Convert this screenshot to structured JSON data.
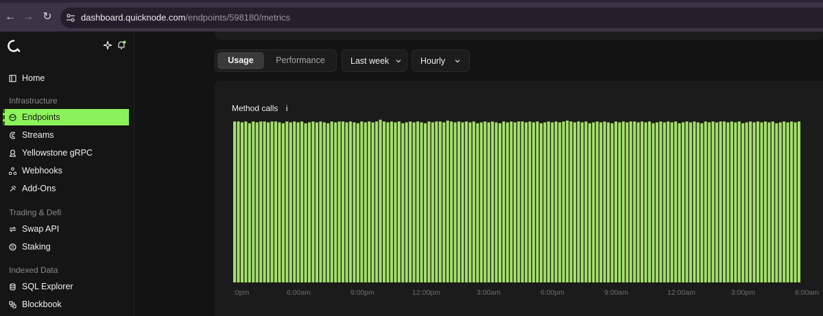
{
  "browser": {
    "url_host": "dashboard.quicknode.com",
    "url_path": "/endpoints/598180/metrics"
  },
  "sidebar": {
    "items": [
      {
        "label": "Home",
        "icon": "home-icon",
        "active": false
      },
      {
        "label": "Endpoints",
        "icon": "endpoints-icon",
        "active": true
      },
      {
        "label": "Streams",
        "icon": "streams-icon",
        "active": false
      },
      {
        "label": "Yellowstone gRPC",
        "icon": "yellowstone-icon",
        "active": false
      },
      {
        "label": "Webhooks",
        "icon": "webhooks-icon",
        "active": false
      },
      {
        "label": "Add-Ons",
        "icon": "addons-icon",
        "active": false
      },
      {
        "label": "Swap API",
        "icon": "swap-icon",
        "active": false
      },
      {
        "label": "Staking",
        "icon": "staking-icon",
        "active": false
      },
      {
        "label": "SQL Explorer",
        "icon": "database-icon",
        "active": false
      },
      {
        "label": "Blockbook",
        "icon": "blockbook-icon",
        "active": false
      }
    ],
    "sections": [
      "Infrastructure",
      "Trading & Defi",
      "Indexed Data"
    ],
    "accent": "#8cf25a"
  },
  "tabs": {
    "usage": "Usage",
    "performance": "Performance"
  },
  "filters": {
    "range": "Last week",
    "granularity": "Hourly"
  },
  "chart_data": {
    "type": "bar",
    "title": "Method calls",
    "info": "i",
    "bar_color": "#a3e06a",
    "tick_labels": [
      ":0pm",
      "6:00am",
      "9:00pm",
      "12:00pm",
      "3:00am",
      "6:00pm",
      "9:00am",
      "12:00am",
      "3:00pm",
      "6:00am"
    ],
    "y_visible_fraction_base": 0.91,
    "values": [
      0.91,
      0.91,
      0.905,
      0.91,
      0.9,
      0.91,
      0.905,
      0.91,
      0.91,
      0.905,
      0.91,
      0.91,
      0.905,
      0.9,
      0.91,
      0.905,
      0.91,
      0.905,
      0.91,
      0.9,
      0.905,
      0.91,
      0.905,
      0.91,
      0.905,
      0.9,
      0.91,
      0.905,
      0.91,
      0.91,
      0.905,
      0.91,
      0.905,
      0.9,
      0.91,
      0.905,
      0.91,
      0.905,
      0.91,
      0.92,
      0.91,
      0.905,
      0.91,
      0.905,
      0.91,
      0.9,
      0.905,
      0.91,
      0.905,
      0.91,
      0.905,
      0.9,
      0.91,
      0.905,
      0.91,
      0.91,
      0.905,
      0.915,
      0.91,
      0.905,
      0.91,
      0.905,
      0.91,
      0.905,
      0.91,
      0.9,
      0.905,
      0.91,
      0.905,
      0.91,
      0.905,
      0.9,
      0.91,
      0.905,
      0.91,
      0.905,
      0.91,
      0.91,
      0.905,
      0.91,
      0.905,
      0.91,
      0.9,
      0.905,
      0.91,
      0.905,
      0.91,
      0.905,
      0.91,
      0.915,
      0.91,
      0.905,
      0.91,
      0.905,
      0.91,
      0.9,
      0.905,
      0.91,
      0.905,
      0.91,
      0.905,
      0.9,
      0.91,
      0.905,
      0.91,
      0.905,
      0.91,
      0.91,
      0.905,
      0.91,
      0.905,
      0.91,
      0.9,
      0.905,
      0.91,
      0.905,
      0.91,
      0.905,
      0.91,
      0.9,
      0.905,
      0.91,
      0.905,
      0.91,
      0.905,
      0.9,
      0.91,
      0.905,
      0.91,
      0.905,
      0.91,
      0.91,
      0.905,
      0.91,
      0.905,
      0.91,
      0.9,
      0.905,
      0.91,
      0.905,
      0.91,
      0.905,
      0.91,
      0.905,
      0.91,
      0.9,
      0.905,
      0.91,
      0.905,
      0.91,
      0.905,
      0.91
    ]
  }
}
